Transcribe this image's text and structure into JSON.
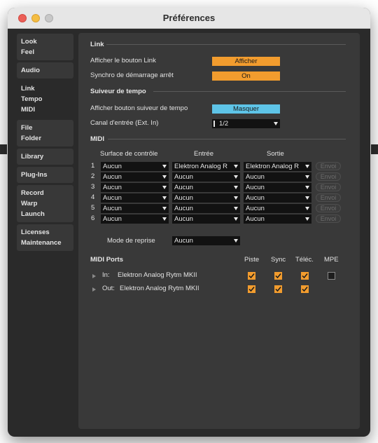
{
  "window": {
    "title": "Préférences"
  },
  "sidebar": {
    "groups": [
      {
        "lines": [
          "Look",
          "Feel"
        ]
      },
      {
        "lines": [
          "Audio"
        ]
      },
      {
        "lines": [
          "Link",
          "Tempo",
          "MIDI"
        ]
      },
      {
        "lines": [
          "File",
          "Folder"
        ]
      },
      {
        "lines": [
          "Library"
        ]
      },
      {
        "lines": [
          "Plug-Ins"
        ]
      },
      {
        "lines": [
          "Record",
          "Warp",
          "Launch"
        ]
      },
      {
        "lines": [
          "Licenses",
          "Maintenance"
        ]
      }
    ]
  },
  "link": {
    "section_title": "Link",
    "show_button_label": "Afficher le bouton Link",
    "show_button_value": "Afficher",
    "sync_label": "Synchro de démarrage arrêt",
    "sync_value": "On"
  },
  "tempo": {
    "section_title": "Suiveur de tempo",
    "show_button_label": "Afficher bouton suiveur de tempo",
    "show_button_value": "Masquer",
    "channel_label": "Canal d'entrée (Ext. In)",
    "channel_value": "1/2"
  },
  "midi": {
    "section_title": "MIDI",
    "col_control_surface": "Surface de contrôle",
    "col_input": "Entrée",
    "col_output": "Sortie",
    "send_label": "Envoi",
    "rows": [
      {
        "num": "1",
        "surface": "Aucun",
        "input": "Elektron Analog R",
        "output": "Elektron Analog R"
      },
      {
        "num": "2",
        "surface": "Aucun",
        "input": "Aucun",
        "output": "Aucun"
      },
      {
        "num": "3",
        "surface": "Aucun",
        "input": "Aucun",
        "output": "Aucun"
      },
      {
        "num": "4",
        "surface": "Aucun",
        "input": "Aucun",
        "output": "Aucun"
      },
      {
        "num": "5",
        "surface": "Aucun",
        "input": "Aucun",
        "output": "Aucun"
      },
      {
        "num": "6",
        "surface": "Aucun",
        "input": "Aucun",
        "output": "Aucun"
      }
    ],
    "takeover_label": "Mode de reprise",
    "takeover_value": "Aucun"
  },
  "ports": {
    "title": "MIDI Ports",
    "col_track": "Piste",
    "col_sync": "Sync",
    "col_remote": "Téléc.",
    "col_mpe": "MPE",
    "rows": [
      {
        "dir": "In:",
        "name": "Elektron Analog Rytm MKII",
        "track": true,
        "sync": true,
        "remote": true,
        "mpe": false
      },
      {
        "dir": "Out:",
        "name": "Elektron Analog Rytm MKII",
        "track": true,
        "sync": true,
        "remote": true
      }
    ]
  }
}
